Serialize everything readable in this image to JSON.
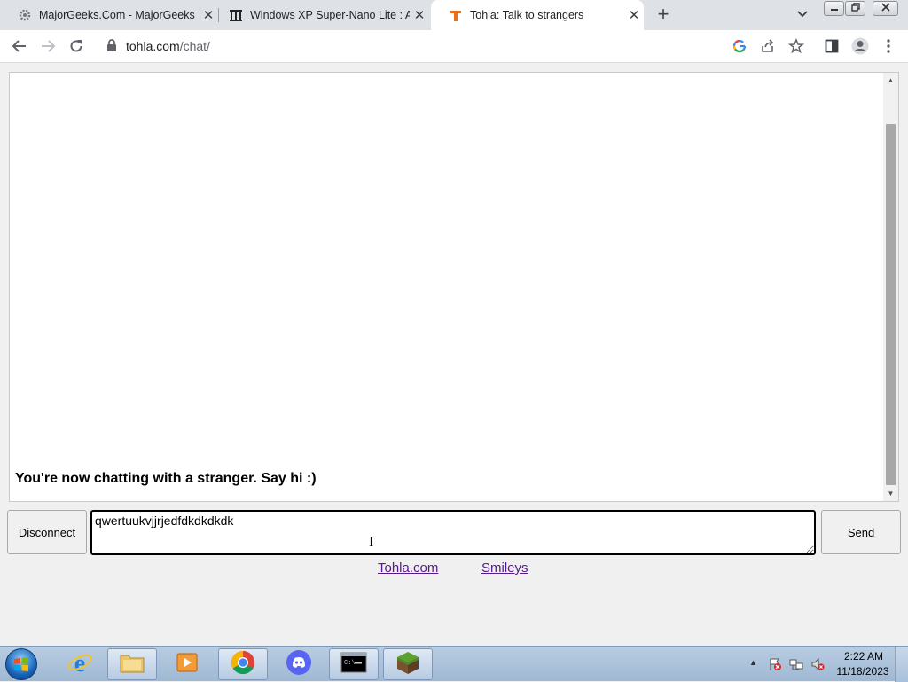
{
  "browser": {
    "tabs": [
      {
        "title": "MajorGeeks.Com - MajorGeeks",
        "icon": "gear-favicon",
        "active": false
      },
      {
        "title": "Windows XP Super-Nano Lite : Al",
        "icon": "archive-favicon",
        "active": false
      },
      {
        "title": "Tohla: Talk to strangers",
        "icon": "tohla-favicon",
        "active": true
      }
    ],
    "close_glyph": "✕",
    "new_tab_glyph": "+",
    "url_domain": "tohla.com",
    "url_path": "/chat/"
  },
  "chat": {
    "status_message": "You're now chatting with a stranger. Say hi :)",
    "disconnect_label": "Disconnect",
    "send_label": "Send",
    "input_value": "qwertuukvjjrjedfdkdkdkdk",
    "links": {
      "home": "Tohla.com",
      "smileys": "Smileys"
    }
  },
  "taskbar": {
    "pinned": [
      "explorer",
      "internet-explorer",
      "file-explorer",
      "media-player",
      "chrome",
      "discord",
      "cmd",
      "minecraft"
    ],
    "clock_time": "2:22 AM",
    "clock_date": "11/18/2023"
  },
  "colors": {
    "tab_strip": "#dee1e6",
    "link": "#551a8b",
    "tohla_brand": "#e8711c",
    "taskbar": "#b9cde2"
  }
}
